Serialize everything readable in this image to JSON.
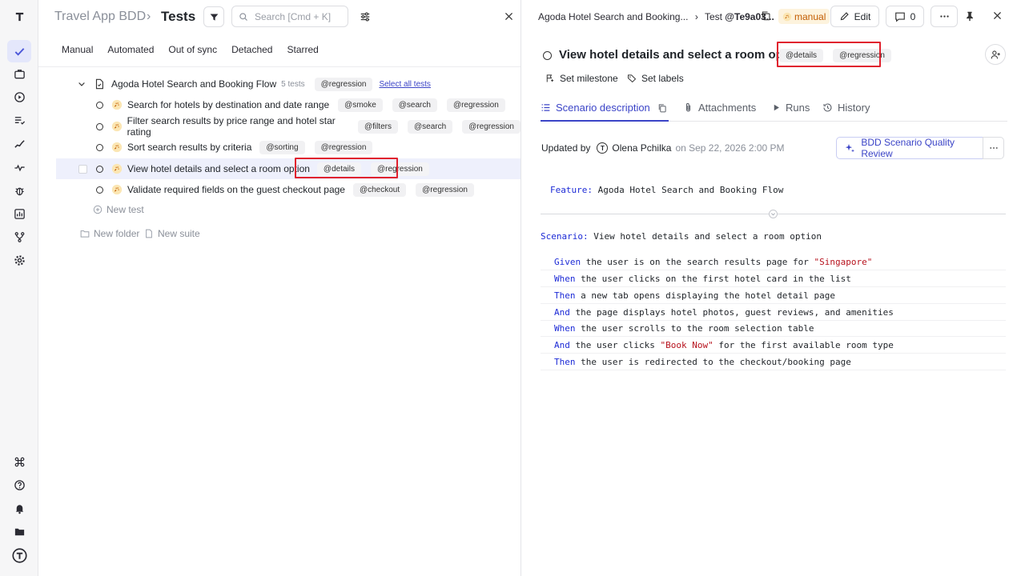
{
  "app": {
    "project": "Travel App BDD",
    "section": "Tests",
    "search_placeholder": "Search [Cmd + K]"
  },
  "tabs": [
    "Manual",
    "Automated",
    "Out of sync",
    "Detached",
    "Starred"
  ],
  "suite": {
    "name": "Agoda Hotel Search and Booking Flow",
    "count": "5 tests",
    "tag": "@regression",
    "select_all": "Select all tests"
  },
  "tests": [
    {
      "title": "Search for hotels by destination and date range",
      "tags": [
        "@smoke",
        "@search",
        "@regression"
      ]
    },
    {
      "title": "Filter search results by price range and hotel star rating",
      "tags": [
        "@filters",
        "@search",
        "@regression"
      ]
    },
    {
      "title": "Sort search results by criteria",
      "tags": [
        "@sorting",
        "@regression"
      ]
    },
    {
      "title": "View hotel details and select a room option",
      "tags": [
        "@details",
        "@regression"
      ]
    },
    {
      "title": "Validate required fields on the guest checkout page",
      "tags": [
        "@checkout",
        "@regression"
      ]
    }
  ],
  "new_test": "New test",
  "new_folder": "New folder",
  "new_suite": "New suite",
  "detail": {
    "breadcrumb_suite": "Agoda Hotel Search and Booking...",
    "breadcrumb_sep": "›",
    "test_prefix": "Test",
    "test_id": "@Te9a03...",
    "manual_label": "manual",
    "edit_label": "Edit",
    "comments_count": "0",
    "title": "View hotel details and select a room option",
    "tags": [
      "@details",
      "@regression"
    ],
    "set_milestone": "Set milestone",
    "set_labels": "Set labels",
    "tabs": [
      "Scenario description",
      "Attachments",
      "Runs",
      "History"
    ],
    "updated_by_label": "Updated by",
    "author": "Olena Pchilka",
    "date": "on Sep 22, 2026 2:00 PM",
    "quality_review": "BDD Scenario Quality Review"
  },
  "gherkin": {
    "feature_kw": "Feature:",
    "feature": "Agoda Hotel Search and Booking Flow",
    "scenario_kw": "Scenario:",
    "scenario": "View hotel details and select a room option",
    "steps": [
      {
        "kw": "Given",
        "pre": "the user is on the search results page for ",
        "str": "\"Singapore\"",
        "post": ""
      },
      {
        "kw": "When",
        "pre": "the user clicks on the first hotel card in the list",
        "str": "",
        "post": ""
      },
      {
        "kw": "Then",
        "pre": "a new tab opens displaying the hotel detail page",
        "str": "",
        "post": ""
      },
      {
        "kw": "And",
        "pre": "the page displays hotel photos, guest reviews, and amenities",
        "str": "",
        "post": ""
      },
      {
        "kw": "When",
        "pre": "the user scrolls to the room selection table",
        "str": "",
        "post": ""
      },
      {
        "kw": "And",
        "pre": "the user clicks ",
        "str": "\"Book Now\"",
        "post": " for the first available room type"
      },
      {
        "kw": "Then",
        "pre": "the user is redirected to the checkout/booking page",
        "str": "",
        "post": ""
      }
    ]
  },
  "colors": {
    "accent": "#3b44c7",
    "highlight": "#e0212e",
    "keyword": "#1d2bd6",
    "string": "#b7121d"
  }
}
